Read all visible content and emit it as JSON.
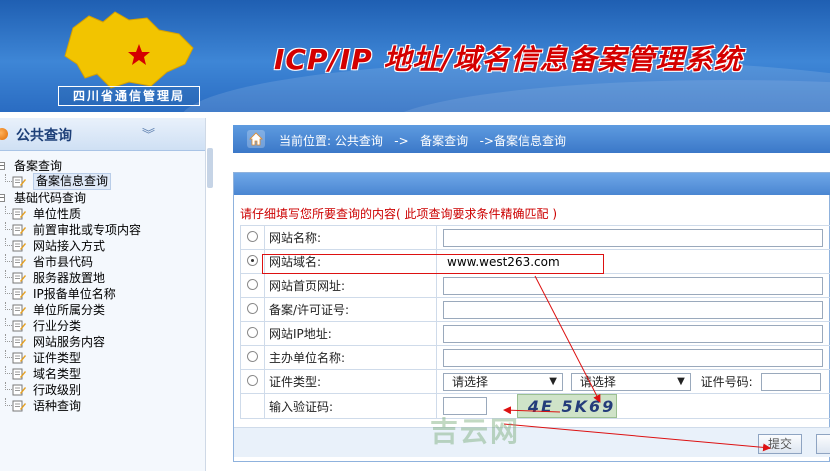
{
  "header": {
    "system_title": "ICP/IP 地址/域名信息备案管理系统",
    "bureau_name": "四川省通信管理局"
  },
  "sidebar": {
    "title": "公共查询",
    "tree": [
      {
        "label": "备案查询",
        "type": "group"
      },
      {
        "label": "备案信息查询",
        "type": "leaf",
        "selected": true
      },
      {
        "label": "基础代码查询",
        "type": "group"
      },
      {
        "label": "单位性质",
        "type": "leaf"
      },
      {
        "label": "前置审批或专项内容",
        "type": "leaf"
      },
      {
        "label": "网站接入方式",
        "type": "leaf"
      },
      {
        "label": "省市县代码",
        "type": "leaf"
      },
      {
        "label": "服务器放置地",
        "type": "leaf"
      },
      {
        "label": "IP报备单位名称",
        "type": "leaf"
      },
      {
        "label": "单位所属分类",
        "type": "leaf"
      },
      {
        "label": "行业分类",
        "type": "leaf"
      },
      {
        "label": "网站服务内容",
        "type": "leaf"
      },
      {
        "label": "证件类型",
        "type": "leaf"
      },
      {
        "label": "域名类型",
        "type": "leaf"
      },
      {
        "label": "行政级别",
        "type": "leaf"
      },
      {
        "label": "语种查询",
        "type": "leaf"
      }
    ]
  },
  "breadcrumb": {
    "text": "当前位置: 公共查询   ->   备案查询   ->备案信息查询"
  },
  "form": {
    "instruction": "请仔细填写您所要查询的内容( 此项查询要求条件精确匹配 )",
    "rows": [
      {
        "label": "网站名称:",
        "value": "",
        "checked": false
      },
      {
        "label": "网站域名:",
        "value": "www.west263.com",
        "checked": true
      },
      {
        "label": "网站首页网址:",
        "value": "",
        "checked": false
      },
      {
        "label": "备案/许可证号:",
        "value": "",
        "checked": false
      },
      {
        "label": "网站IP地址:",
        "value": "",
        "checked": false
      },
      {
        "label": "主办单位名称:",
        "value": "",
        "checked": false
      }
    ],
    "cert_type_label": "证件类型:",
    "cert_select_1": "请选择",
    "cert_select_2": "请选择",
    "cert_no_label": "证件号码:",
    "captcha_label": "输入验证码:",
    "captcha_text": "4E 5K69",
    "submit_label": "提交"
  },
  "watermark": "吉云网",
  "colors": {
    "header_blue": "#2a6cc2",
    "title_red": "#d40000",
    "instruction_red": "#cc0000",
    "annotation_red": "#dd1111"
  }
}
